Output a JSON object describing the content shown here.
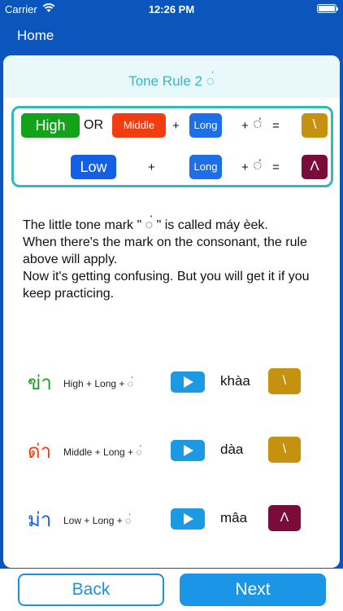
{
  "status": {
    "carrier": "Carrier",
    "time": "12:26 PM"
  },
  "nav": {
    "home": "Home"
  },
  "title": "Tone Rule 2 ◌่",
  "rule": {
    "row1": {
      "high": "High",
      "or": "OR",
      "middle": "Middle",
      "plus": "+",
      "long": "Long",
      "plus_mark": "+",
      "mark": "◌่",
      "equals": "=",
      "result": "\\"
    },
    "row2": {
      "low": "Low",
      "plus": "+",
      "long": "Long",
      "plus_mark": "+",
      "mark": "◌่",
      "equals": "=",
      "result": "Λ"
    }
  },
  "explanation": {
    "line1": "The little tone mark \" ◌่ \" is called máy èek.",
    "line2": "When there's the mark on the consonant, the rule above will apply.",
    "line3": "Now it's getting confusing. But you will get it if you keep practicing."
  },
  "examples": [
    {
      "thai": "ข่า",
      "color": "#14a21a",
      "formula": "High + Long + ◌่",
      "translit": "khàa",
      "result": "\\",
      "result_color": "#c59210"
    },
    {
      "thai": "ด่า",
      "color": "#f23d10",
      "formula": "Middle + Long + ◌่",
      "translit": "dàa",
      "result": "\\",
      "result_color": "#c59210"
    },
    {
      "thai": "ม่า",
      "color": "#1360e6",
      "formula": "Low + Long + ◌่",
      "translit": "mâa",
      "result": "Λ",
      "result_color": "#7a0c3c"
    }
  ],
  "buttons": {
    "back": "Back",
    "next": "Next"
  },
  "colors": {
    "brand": "#0a56bd",
    "accent": "#1b96e6",
    "title": "#30b9c6"
  }
}
